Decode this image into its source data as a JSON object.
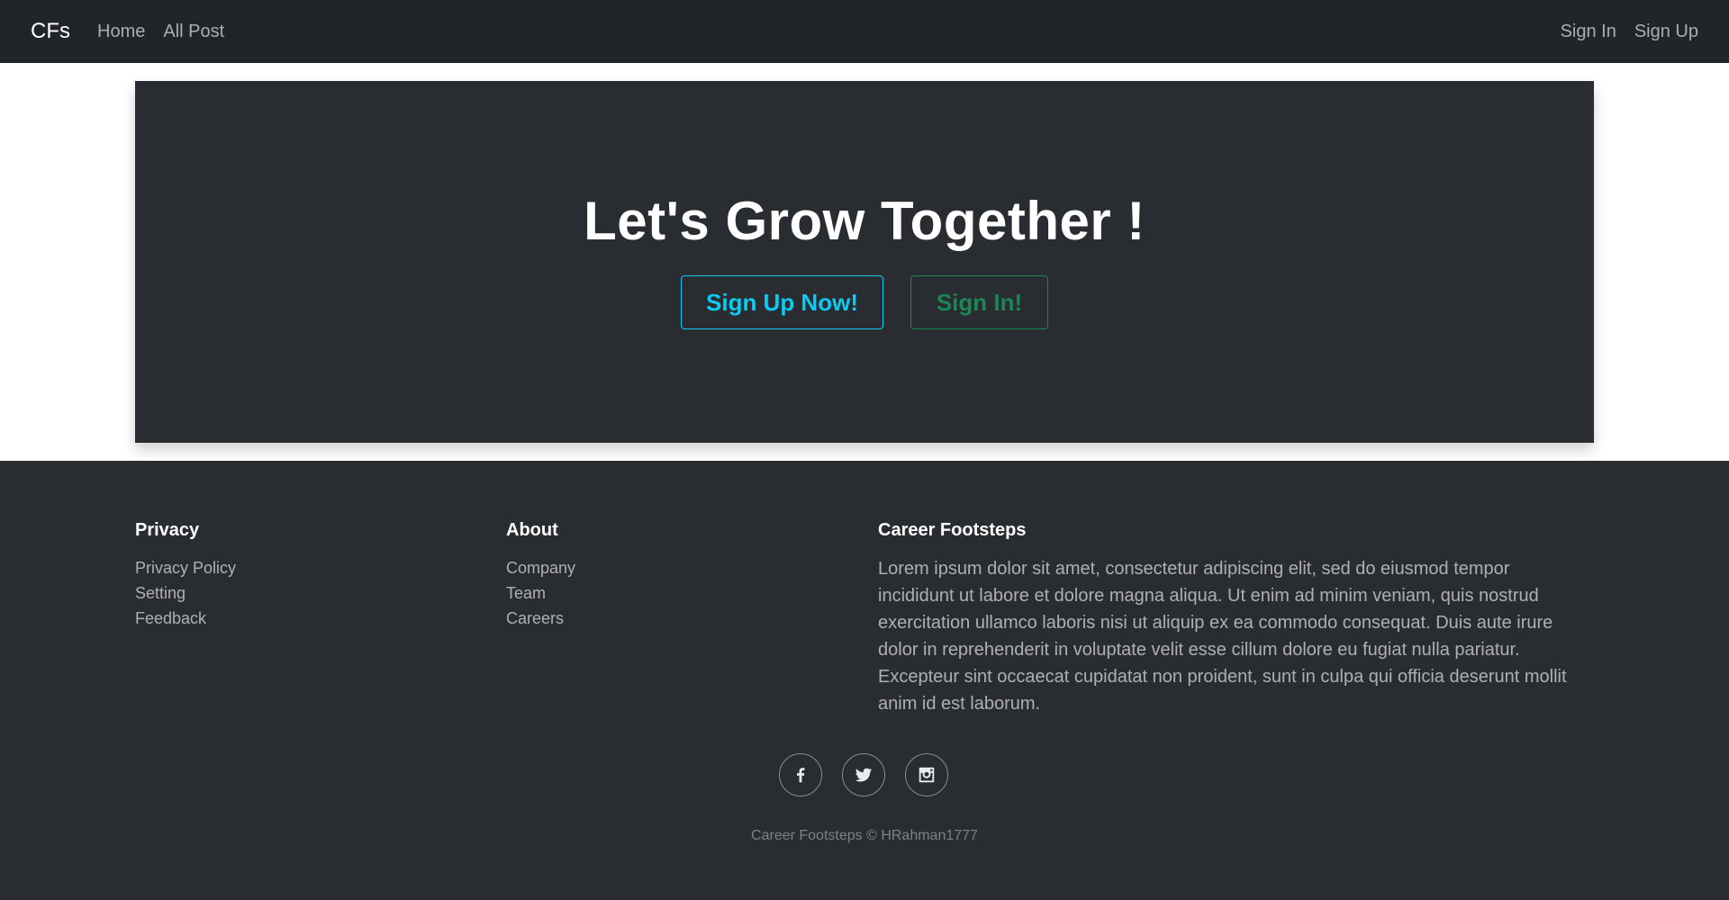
{
  "navbar": {
    "brand": "CFs",
    "links": [
      "Home",
      "All Post"
    ],
    "right_links": [
      "Sign In",
      "Sign Up"
    ]
  },
  "hero": {
    "title": "Let's Grow Together !",
    "signup_button": "Sign Up Now!",
    "signin_button": "Sign In!"
  },
  "footer": {
    "privacy": {
      "heading": "Privacy",
      "links": [
        "Privacy Policy",
        "Setting",
        "Feedback"
      ]
    },
    "about": {
      "heading": "About",
      "links": [
        "Company",
        "Team",
        "Careers"
      ]
    },
    "career": {
      "heading": "Career Footsteps",
      "text": "Lorem ipsum dolor sit amet, consectetur adipiscing elit, sed do eiusmod tempor incididunt ut labore et dolore magna aliqua. Ut enim ad minim veniam, quis nostrud exercitation ullamco laboris nisi ut aliquip ex ea commodo consequat. Duis aute irure dolor in reprehenderit in voluptate velit esse cillum dolore eu fugiat nulla pariatur. Excepteur sint occaecat cupidatat non proident, sunt in culpa qui officia deserunt mollit anim id est laborum."
    },
    "social_icons": [
      "facebook-icon",
      "twitter-icon",
      "instagram-icon"
    ],
    "copyright": "Career Footsteps © HRahman1777"
  },
  "colors": {
    "navbar_bg": "#212529",
    "hero_bg": "#292c31",
    "info": "#0dcaf0",
    "success": "#198754"
  }
}
